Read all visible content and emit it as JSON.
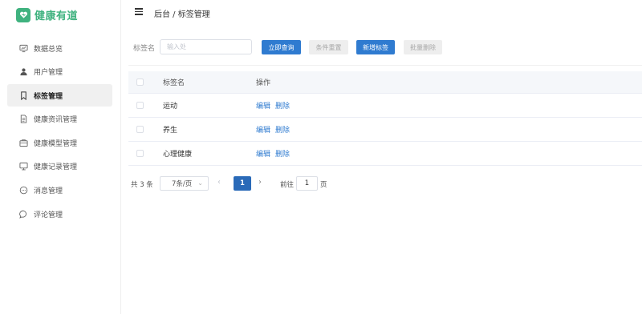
{
  "app": {
    "title": "健康有道",
    "brand_color": "#3fb27f",
    "accent_color": "#2f7bd0"
  },
  "sidebar": {
    "items": [
      {
        "label": "数据总览",
        "icon": "monitor-chart-icon",
        "active": false
      },
      {
        "label": "用户管理",
        "icon": "user-icon",
        "active": false
      },
      {
        "label": "标签管理",
        "icon": "bookmark-icon",
        "active": true
      },
      {
        "label": "健康资讯管理",
        "icon": "document-icon",
        "active": false
      },
      {
        "label": "健康模型管理",
        "icon": "folder-icon",
        "active": false
      },
      {
        "label": "健康记录管理",
        "icon": "monitor-icon",
        "active": false
      },
      {
        "label": "消息管理",
        "icon": "message-dots-icon",
        "active": false
      },
      {
        "label": "评论管理",
        "icon": "comment-icon",
        "active": false
      }
    ]
  },
  "header": {
    "breadcrumb": "后台 / 标签管理"
  },
  "search": {
    "label": "标签名",
    "placeholder": "输入处",
    "value": "",
    "buttons": {
      "query": "立即查询",
      "reset": "条件重置",
      "add": "新增标签",
      "batch_delete": "批量删除"
    }
  },
  "table": {
    "columns": [
      "标签名",
      "操作"
    ],
    "rows": [
      {
        "name": "运动"
      },
      {
        "name": "养生"
      },
      {
        "name": "心理健康"
      }
    ],
    "actions": {
      "edit": "编辑",
      "delete": "删除"
    }
  },
  "pagination": {
    "total_text": "共 3 条",
    "page_size": "7条/页",
    "current_page": "1",
    "goto_label": "前往",
    "goto_value": "1",
    "page_unit": "页"
  }
}
